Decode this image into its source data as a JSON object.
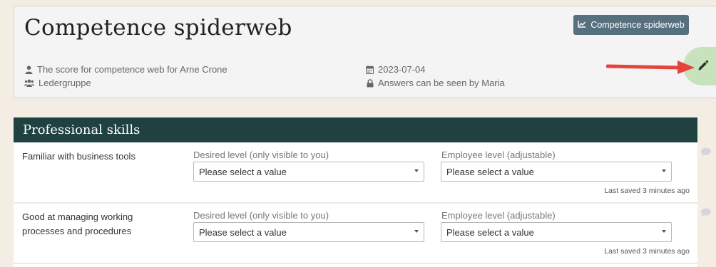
{
  "header": {
    "title": "Competence spiderweb",
    "button_label": "Competence spiderweb",
    "score_text": "The score for competence web for Arne Crone",
    "group": "Ledergruppe",
    "date": "2023-07-04",
    "visibility": "Answers can be seen by Maria"
  },
  "section": {
    "title": "Professional skills",
    "rows": [
      {
        "label": "Familiar with business tools",
        "desired_label": "Desired level (only visible to you)",
        "desired_value": "Please select a value",
        "employee_label": "Employee level (adjustable)",
        "employee_value": "Please select a value",
        "saved": "Last saved 3 minutes ago"
      },
      {
        "label": "Good at managing working processes and procedures",
        "desired_label": "Desired level (only visible to you)",
        "desired_value": "Please select a value",
        "employee_label": "Employee level (adjustable)",
        "employee_value": "Please select a value",
        "saved": "Last saved 3 minutes ago"
      }
    ]
  },
  "icons": {
    "user": "user-icon",
    "group": "users-icon",
    "calendar": "calendar-icon",
    "lock": "lock-icon",
    "chart": "line-chart-icon",
    "edit": "pencil-icon",
    "comment": "comment-icon"
  },
  "colors": {
    "section_header": "#1f4240",
    "button": "#56707e",
    "fab": "#c8e2bd",
    "arrow": "#e8423c"
  }
}
